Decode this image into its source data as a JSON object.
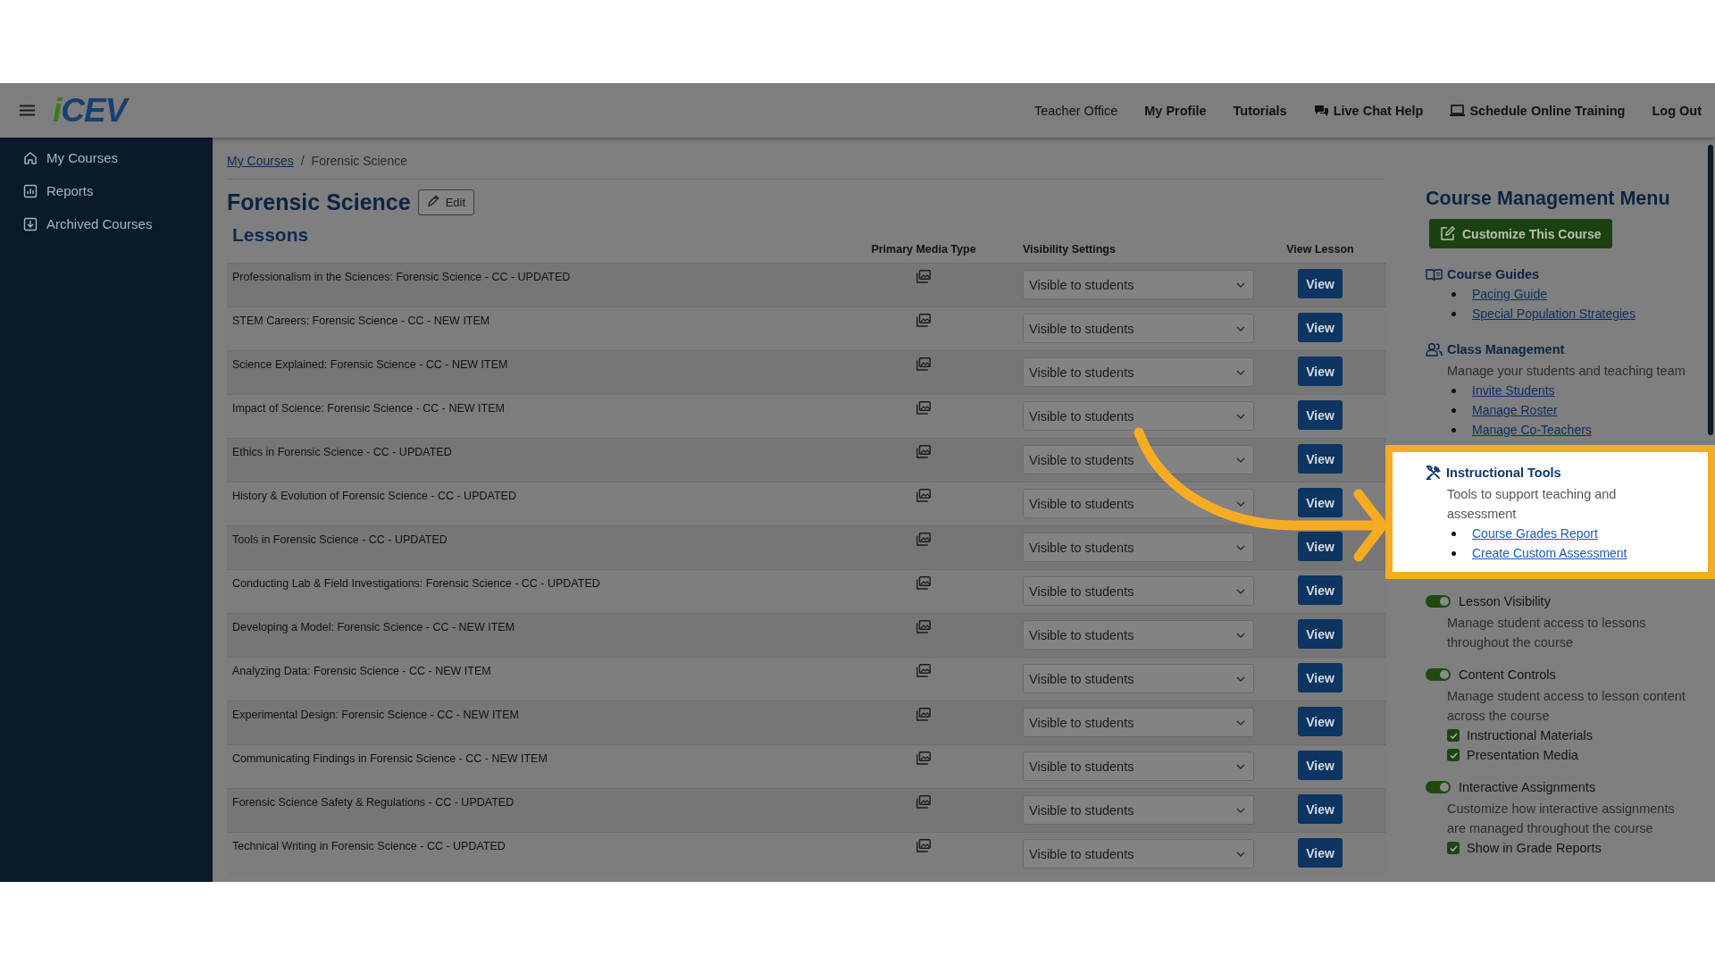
{
  "header": {
    "logo": "iCEV",
    "nav": [
      {
        "label": "Teacher Office",
        "kind": "link",
        "selected": true
      },
      {
        "label": "My Profile",
        "kind": "link",
        "selected": false
      },
      {
        "label": "Tutorials",
        "kind": "link",
        "selected": false
      },
      {
        "label": "Live Chat Help",
        "kind": "chat",
        "selected": false
      },
      {
        "label": "Schedule Online Training",
        "kind": "training",
        "selected": false
      },
      {
        "label": "Log Out",
        "kind": "link",
        "selected": false
      }
    ]
  },
  "sidebar": {
    "items": [
      {
        "label": "My Courses",
        "kind": "home"
      },
      {
        "label": "Reports",
        "kind": "reports"
      },
      {
        "label": "Archived Courses",
        "kind": "archive"
      }
    ]
  },
  "breadcrumb": {
    "separator": "/",
    "items": [
      {
        "label": "My Courses",
        "link": true
      },
      {
        "label": "Forensic Science",
        "link": false
      }
    ]
  },
  "course": {
    "title": "Forensic Science",
    "edit_button": "Edit"
  },
  "lessons": {
    "heading": "Lessons",
    "columns": [
      "Primary Media Type",
      "Visibility Settings",
      "View Lesson"
    ],
    "rows": [
      {
        "title": "Professionalism in the Sciences: Forensic Science - CC - UPDATED",
        "visibility": "Visible to students",
        "action": "View"
      },
      {
        "title": "STEM Careers: Forensic Science - CC - NEW ITEM",
        "visibility": "Visible to students",
        "action": "View"
      },
      {
        "title": "Science Explained: Forensic Science - CC - NEW ITEM",
        "visibility": "Visible to students",
        "action": "View"
      },
      {
        "title": "Impact of Science: Forensic Science - CC - NEW ITEM",
        "visibility": "Visible to students",
        "action": "View"
      },
      {
        "title": "Ethics in Forensic Science - CC - UPDATED",
        "visibility": "Visible to students",
        "action": "View"
      },
      {
        "title": "History & Evolution of Forensic Science - CC - UPDATED",
        "visibility": "Visible to students",
        "action": "View"
      },
      {
        "title": "Tools in Forensic Science - CC - UPDATED",
        "visibility": "Visible to students",
        "action": "View"
      },
      {
        "title": "Conducting Lab & Field Investigations: Forensic Science - CC - UPDATED",
        "visibility": "Visible to students",
        "action": "View"
      },
      {
        "title": "Developing a Model: Forensic Science - CC - NEW ITEM",
        "visibility": "Visible to students",
        "action": "View"
      },
      {
        "title": "Analyzing Data: Forensic Science - CC - NEW ITEM",
        "visibility": "Visible to students",
        "action": "View"
      },
      {
        "title": "Experimental Design: Forensic Science - CC - NEW ITEM",
        "visibility": "Visible to students",
        "action": "View"
      },
      {
        "title": "Communicating Findings in Forensic Science - CC - NEW ITEM",
        "visibility": "Visible to students",
        "action": "View"
      },
      {
        "title": "Forensic Science Safety & Regulations - CC - UPDATED",
        "visibility": "Visible to students",
        "action": "View"
      },
      {
        "title": "Technical Writing in Forensic Science - CC - UPDATED",
        "visibility": "Visible to students",
        "action": "View"
      }
    ]
  },
  "menu": {
    "title": "Course Management Menu",
    "customize_button": "Customize This Course",
    "sections": [
      {
        "kind": "guides",
        "title": "Course Guides",
        "highlighted": false,
        "links": [
          "Pacing Guide",
          "Special Population Strategies"
        ]
      },
      {
        "kind": "class",
        "title": "Class Management",
        "highlighted": false,
        "description": "Manage your students and teaching team",
        "links": [
          "Invite Students",
          "Manage Roster",
          "Manage Co-Teachers"
        ]
      },
      {
        "kind": "tools",
        "title": "Instructional Tools",
        "highlighted": true,
        "description": "Tools to support teaching and assessment",
        "links": [
          "Course Grades Report",
          "Create Custom Assessment"
        ]
      },
      {
        "kind": "toggle",
        "title": "Lesson Visibility",
        "highlighted": false,
        "on": true,
        "description": "Manage student access to lessons throughout the course"
      },
      {
        "kind": "toggle",
        "title": "Content Controls",
        "highlighted": false,
        "on": true,
        "description": "Manage student access to lesson content across the course",
        "options": [
          {
            "label": "Instructional Materials",
            "checked": true
          },
          {
            "label": "Presentation Media",
            "checked": true
          }
        ]
      },
      {
        "kind": "toggle",
        "title": "Interactive Assignments",
        "highlighted": false,
        "on": true,
        "description": "Customize how interactive assignments are managed throughout the course",
        "options": [
          {
            "label": "Show in Grade Reports",
            "checked": true
          }
        ]
      }
    ]
  }
}
